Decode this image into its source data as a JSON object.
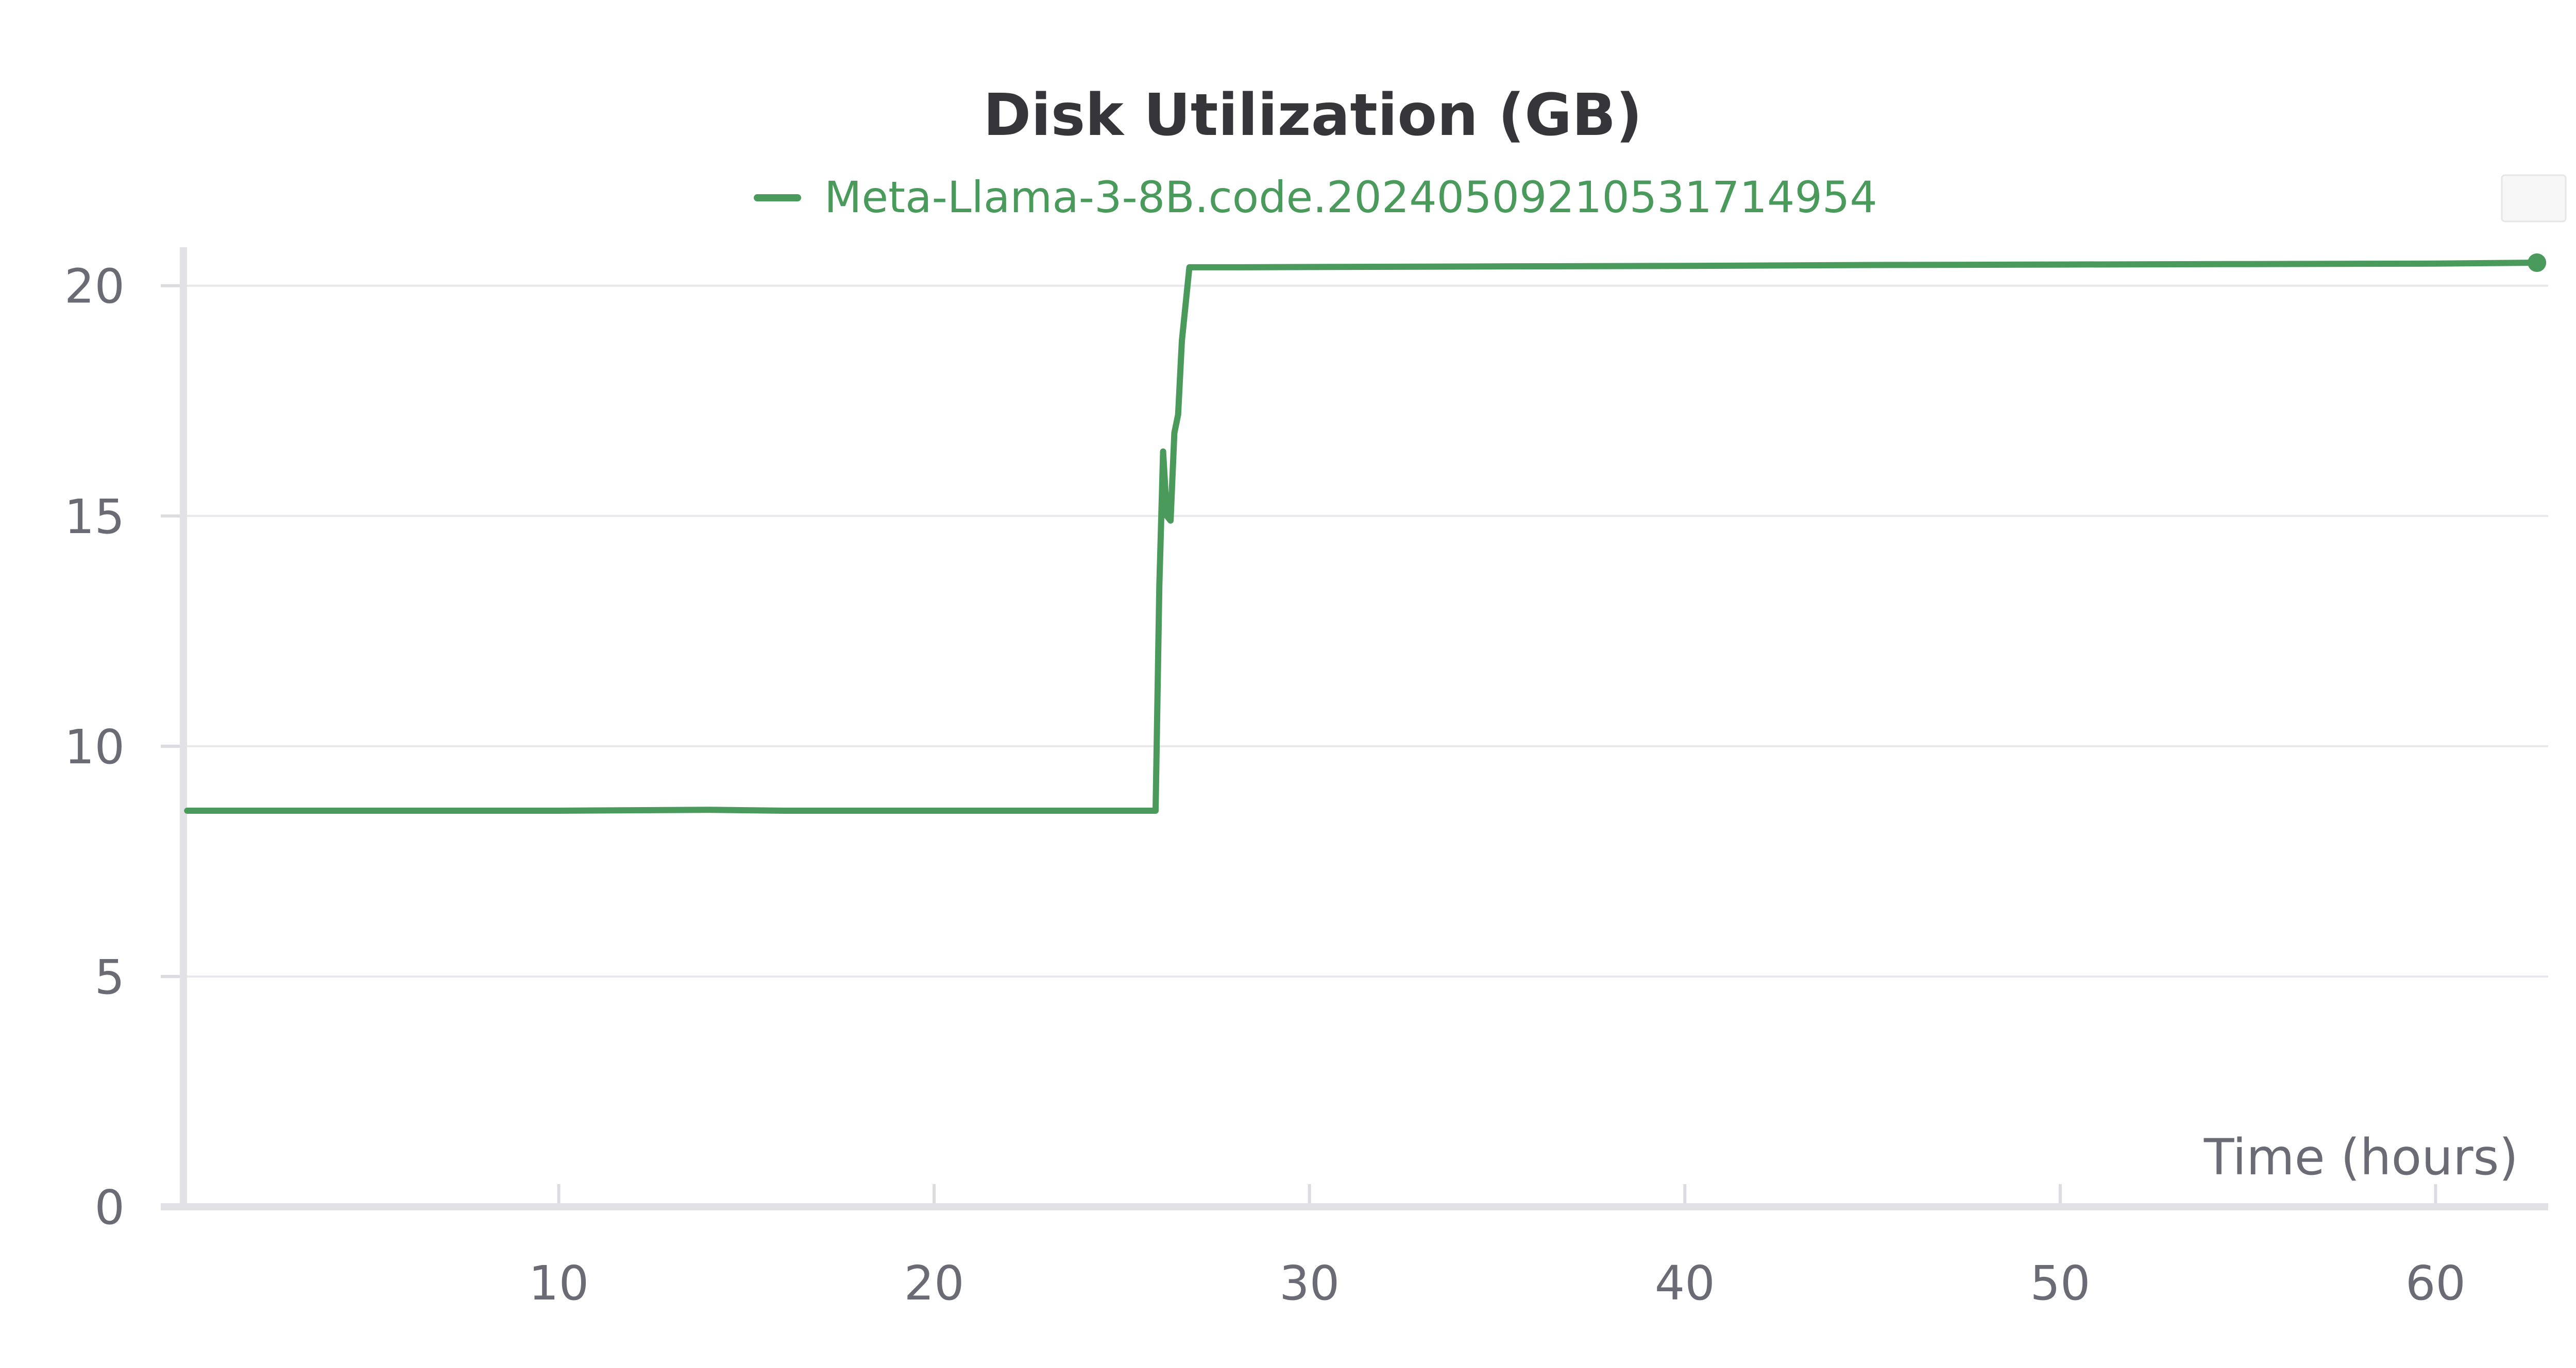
{
  "chart_data": {
    "type": "line",
    "title": "Disk Utilization (GB)",
    "xlabel": "Time (hours)",
    "ylabel": "",
    "xlim": [
      0,
      63
    ],
    "ylim": [
      0,
      20.5
    ],
    "x_ticks": [
      10,
      20,
      30,
      40,
      50,
      60
    ],
    "y_ticks": [
      0,
      5,
      10,
      15,
      20
    ],
    "grid": true,
    "legend_position": "top-center",
    "series": [
      {
        "name": "Meta-Llama-3-8B.code.20240509210531714954",
        "color": "#4a9a5c",
        "x": [
          0.1,
          5,
          10,
          14,
          16,
          20,
          25.9,
          26.0,
          26.1,
          26.2,
          26.3,
          26.4,
          26.5,
          26.6,
          26.8,
          28,
          35,
          40,
          45,
          50,
          55,
          60,
          62.7
        ],
        "y": [
          8.6,
          8.6,
          8.6,
          8.62,
          8.6,
          8.6,
          8.6,
          13.5,
          16.4,
          15.0,
          14.9,
          16.8,
          17.2,
          18.8,
          20.4,
          20.4,
          20.42,
          20.43,
          20.45,
          20.46,
          20.47,
          20.48,
          20.5
        ]
      }
    ]
  }
}
